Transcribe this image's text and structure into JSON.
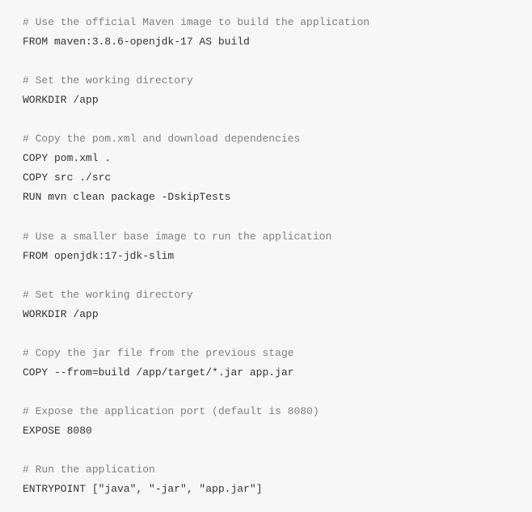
{
  "dockerfile": {
    "lines": [
      {
        "type": "comment",
        "text": "# Use the official Maven image to build the application"
      },
      {
        "type": "code",
        "text": "FROM maven:3.8.6-openjdk-17 AS build"
      },
      {
        "type": "blank",
        "text": ""
      },
      {
        "type": "comment",
        "text": "# Set the working directory"
      },
      {
        "type": "code",
        "text": "WORKDIR /app"
      },
      {
        "type": "blank",
        "text": ""
      },
      {
        "type": "comment",
        "text": "# Copy the pom.xml and download dependencies"
      },
      {
        "type": "code",
        "text": "COPY pom.xml ."
      },
      {
        "type": "code",
        "text": "COPY src ./src"
      },
      {
        "type": "code",
        "text": "RUN mvn clean package -DskipTests"
      },
      {
        "type": "blank",
        "text": ""
      },
      {
        "type": "comment",
        "text": "# Use a smaller base image to run the application"
      },
      {
        "type": "code",
        "text": "FROM openjdk:17-jdk-slim"
      },
      {
        "type": "blank",
        "text": ""
      },
      {
        "type": "comment",
        "text": "# Set the working directory"
      },
      {
        "type": "code",
        "text": "WORKDIR /app"
      },
      {
        "type": "blank",
        "text": ""
      },
      {
        "type": "comment",
        "text": "# Copy the jar file from the previous stage"
      },
      {
        "type": "code",
        "text": "COPY --from=build /app/target/*.jar app.jar"
      },
      {
        "type": "blank",
        "text": ""
      },
      {
        "type": "comment",
        "text": "# Expose the application port (default is 8080)"
      },
      {
        "type": "code",
        "text": "EXPOSE 8080"
      },
      {
        "type": "blank",
        "text": ""
      },
      {
        "type": "comment",
        "text": "# Run the application"
      },
      {
        "type": "code",
        "text": "ENTRYPOINT [\"java\", \"-jar\", \"app.jar\"]"
      }
    ]
  }
}
